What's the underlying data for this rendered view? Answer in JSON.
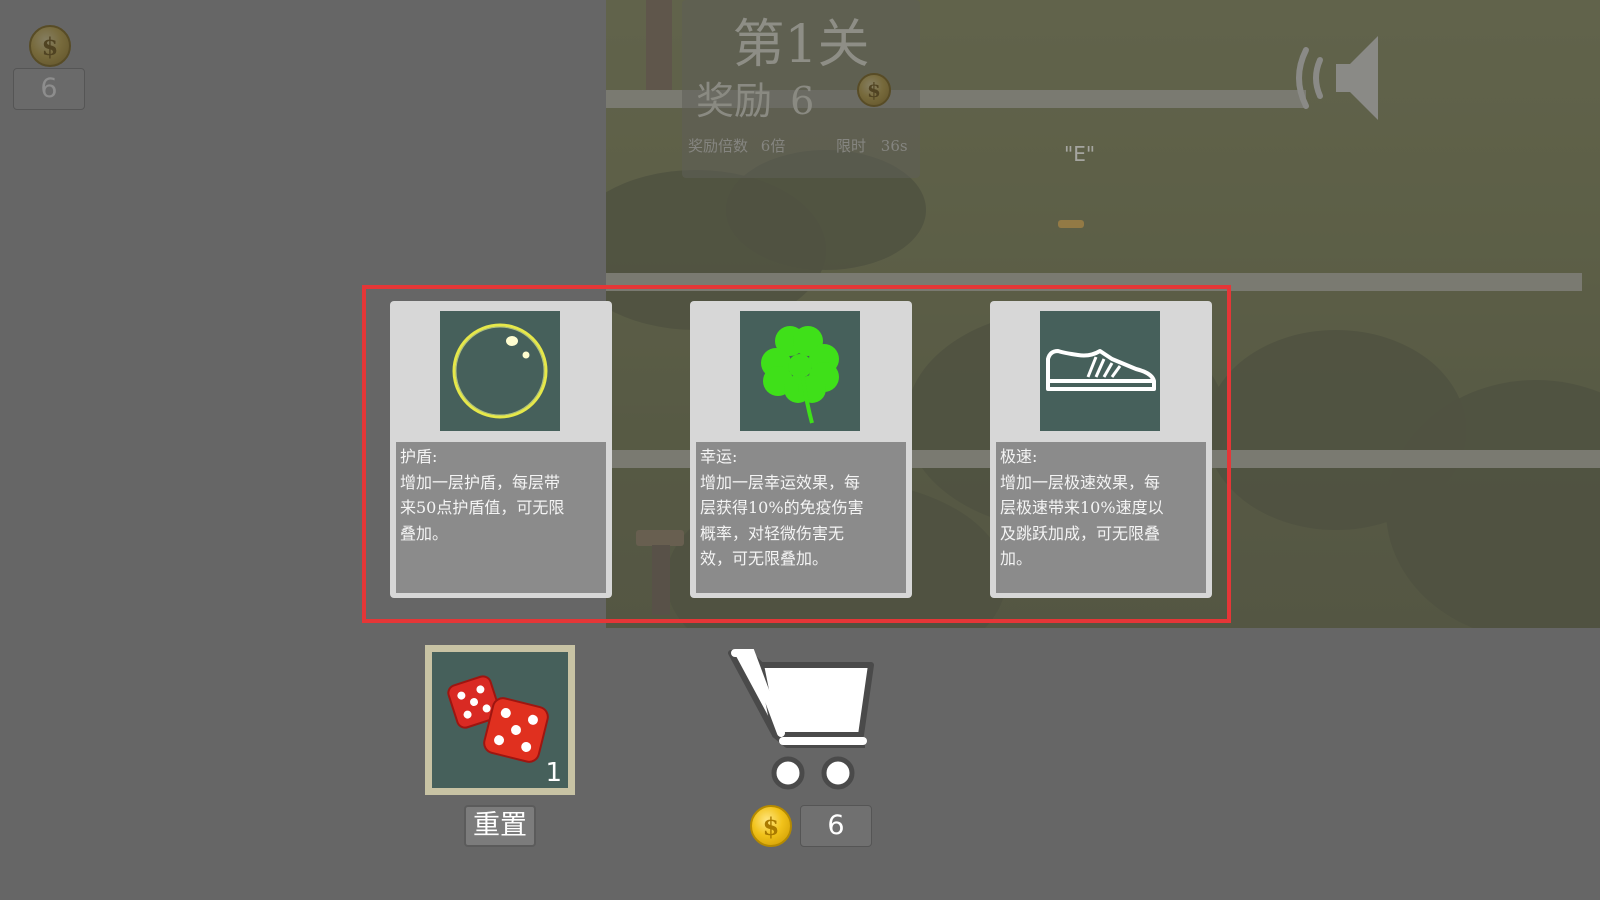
{
  "hud": {
    "coins": "6"
  },
  "level": {
    "title": "第1关",
    "reward_label": "奖励",
    "reward_value": "6",
    "multiplier_label": "奖励倍数",
    "multiplier_value": "6倍",
    "time_label": "限时",
    "time_value": "36s"
  },
  "scene": {
    "key_hint": "\"E\""
  },
  "cards": [
    {
      "icon": "bubble-shield-icon",
      "title": "护盾:",
      "desc": "增加一层护盾，每层带\n来50点护盾值，可无限\n叠加。"
    },
    {
      "icon": "four-leaf-clover-icon",
      "title": "幸运:",
      "desc": "增加一层幸运效果，每\n层获得10%的免疫伤害\n概率，对轻微伤害无\n效，可无限叠加。"
    },
    {
      "icon": "sneaker-icon",
      "title": "极速:",
      "desc": "增加一层极速效果，每\n层极速带来10%速度以\n及跳跃加成，可无限叠\n加。"
    }
  ],
  "reroll": {
    "icon": "dice-icon",
    "count": "1",
    "label": "重置"
  },
  "shop": {
    "icon": "shopping-cart-icon",
    "price": "6"
  },
  "colors": {
    "highlight": "#e53637",
    "card_icon_bg": "#46605b",
    "coin": "#f1c21a"
  }
}
